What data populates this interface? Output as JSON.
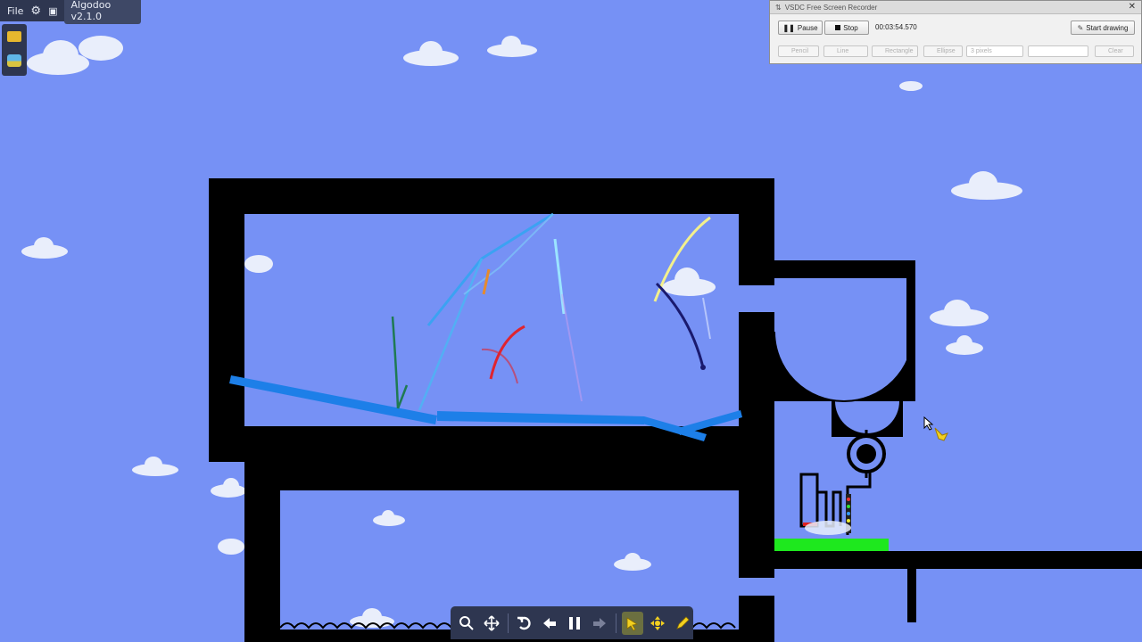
{
  "algodoo": {
    "file_menu": "File",
    "version": "Algodoo v2.1.0",
    "icons": [
      "gear-icon",
      "window-icon",
      "folder-icon",
      "scene-icon"
    ]
  },
  "recorder": {
    "title": "VSDC Free Screen Recorder",
    "pause_label": "Pause",
    "stop_label": "Stop",
    "timer": "00:03:54.570",
    "start_drawing_label": "Start drawing",
    "tools": {
      "pencil": "Pencil",
      "line": "Line",
      "rectangle": "Rectangle",
      "ellipse": "Ellipse",
      "pixels": "3 pixels",
      "clear": "Clear"
    }
  },
  "toolbar": {
    "icons": [
      "zoom-icon",
      "move-icon",
      "undo-icon",
      "back-icon",
      "pause-icon",
      "redo-icon",
      "drag-tool-icon",
      "move-tool-icon",
      "pencil-tool-icon"
    ],
    "active_tool": "drag-tool-icon"
  },
  "colors": {
    "sky": "#7691f5",
    "wall": "#000000",
    "plank": "#1d7fe8",
    "green_platform": "#1ee81e",
    "toolbar_bg": "#2e3650"
  }
}
